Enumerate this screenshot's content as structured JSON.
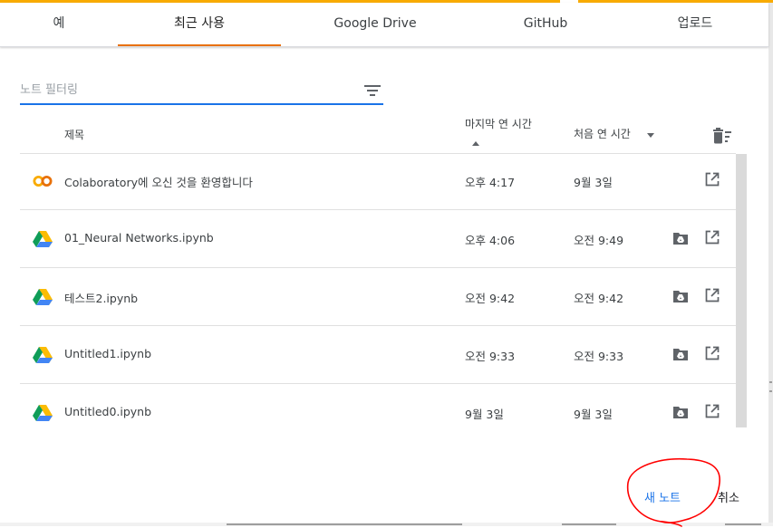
{
  "tabs": [
    {
      "label": "예"
    },
    {
      "label": "최근 사용",
      "active": true
    },
    {
      "label": "Google Drive"
    },
    {
      "label": "GitHub"
    },
    {
      "label": "업로드"
    }
  ],
  "filter": {
    "placeholder": "노트 필터링",
    "value": ""
  },
  "table": {
    "columns": {
      "title": "제목",
      "last_opened": "마지막 연 시간",
      "first_opened": "처음 연 시간"
    },
    "sort": {
      "last_opened": "ascending",
      "first_opened": "descending"
    },
    "rows": [
      {
        "icon": "colab-icon",
        "name": "Colaboratory에 오신 것을 환영합니다",
        "last": "오후 4:17",
        "first": "9월 3일",
        "drive_folder": false
      },
      {
        "icon": "google-drive-icon",
        "name": "01_Neural Networks.ipynb",
        "last": "오후 4:06",
        "first": "오전 9:49",
        "drive_folder": true
      },
      {
        "icon": "google-drive-icon",
        "name": "테스트2.ipynb",
        "last": "오전 9:42",
        "first": "오전 9:42",
        "drive_folder": true
      },
      {
        "icon": "google-drive-icon",
        "name": "Untitled1.ipynb",
        "last": "오전 9:33",
        "first": "오전 9:33",
        "drive_folder": true
      },
      {
        "icon": "google-drive-icon",
        "name": "Untitled0.ipynb",
        "last": "9월 3일",
        "first": "9월 3일",
        "drive_folder": true
      }
    ]
  },
  "footer": {
    "new_notebook": "새 노트",
    "cancel": "취소"
  },
  "colors": {
    "tab_accent": "#e8710a",
    "top_stripe": "#f9ab00",
    "filter_underline": "#1a73e8",
    "link_blue": "#1a73e8",
    "annotation_red": "#ff0000",
    "colab_orange": "#f9ab00"
  }
}
